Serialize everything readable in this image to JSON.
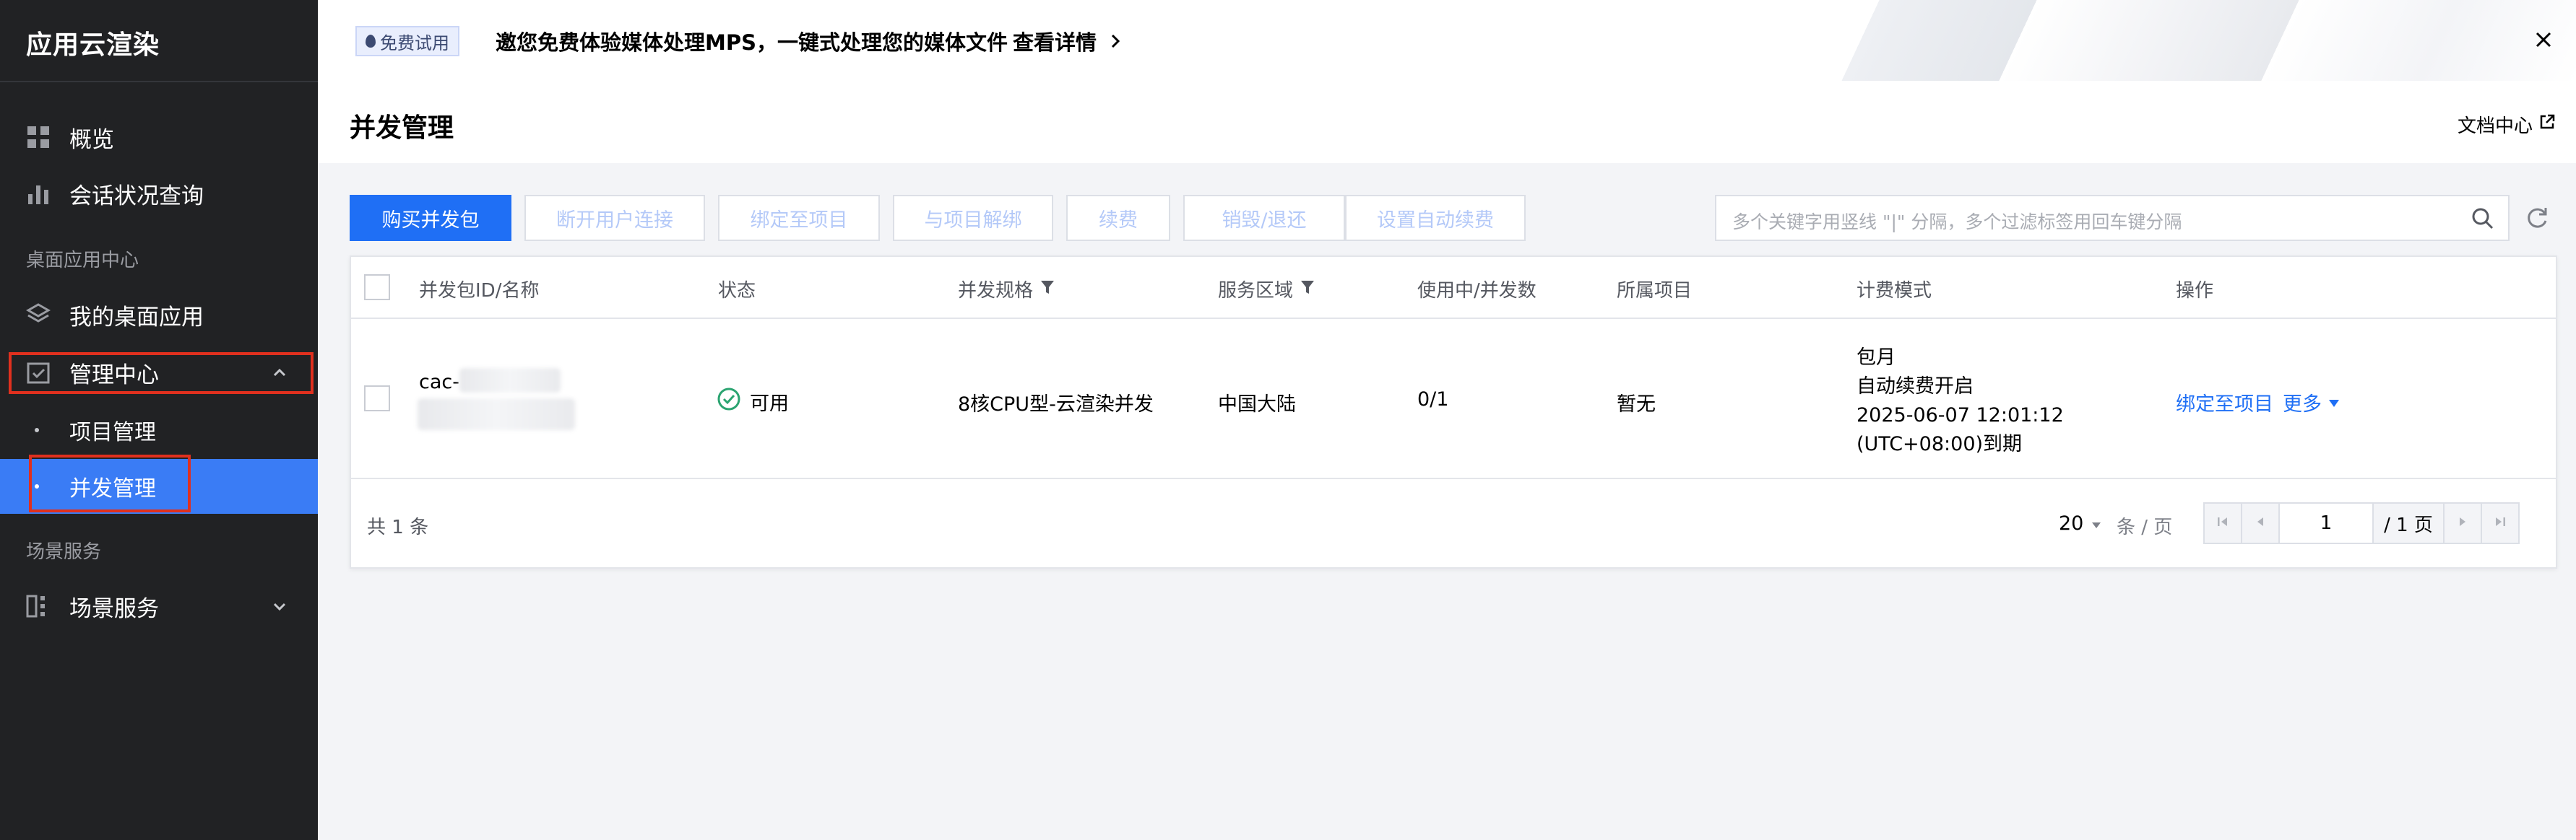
{
  "sidebar": {
    "title": "应用云渲染",
    "items": [
      {
        "label": "概览"
      },
      {
        "label": "会话状况查询"
      }
    ],
    "group_desktop": "桌面应用中心",
    "my_desktop_apps": "我的桌面应用",
    "management_center": "管理中心",
    "sub_items": [
      {
        "label": "项目管理"
      },
      {
        "label": "并发管理"
      }
    ],
    "group_scene": "场景服务",
    "scene_service": "场景服务"
  },
  "banner": {
    "badge": "免费试用",
    "text": "邀您免费体验媒体处理MPS，一键式处理您的媒体文件",
    "link": "查看详情"
  },
  "header": {
    "title": "并发管理",
    "doc_link": "文档中心"
  },
  "toolbar": {
    "buttons": [
      "购买并发包",
      "断开用户连接",
      "绑定至项目",
      "与项目解绑",
      "续费",
      "销毁/退还",
      "设置自动续费"
    ],
    "search_placeholder": "多个关键字用竖线 \"|\" 分隔，多个过滤标签用回车键分隔"
  },
  "table": {
    "columns": [
      "并发包ID/名称",
      "状态",
      "并发规格",
      "服务区域",
      "使用中/并发数",
      "所属项目",
      "计费模式",
      "操作"
    ],
    "rows": [
      {
        "id": "cac-",
        "status": "可用",
        "spec": "8核CPU型-云渲染并发",
        "region": "中国大陆",
        "usage": "0/1",
        "project": "暂无",
        "billing": [
          "包月",
          "自动续费开启",
          "2025-06-07 12:01:12",
          "(UTC+08:00)到期"
        ],
        "actions": {
          "bind": "绑定至项目",
          "more": "更多"
        }
      }
    ],
    "footer": {
      "total": "共 1 条",
      "page_size": "20",
      "per_page": "条 / 页",
      "current_page": "1",
      "total_pages": "/ 1 页"
    }
  },
  "colors": {
    "sidebar_bg": "#212224",
    "active_bg": "#3a7cf5",
    "primary": "#1f6ff5",
    "highlight_border": "#e0301e",
    "status_ok": "#2ba471"
  }
}
